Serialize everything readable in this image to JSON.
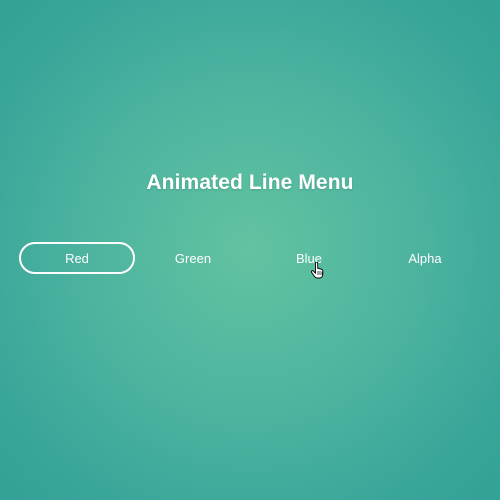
{
  "page": {
    "title": "Animated Line Menu"
  },
  "menu": {
    "items": [
      {
        "label": "Red",
        "active": true
      },
      {
        "label": "Green",
        "active": false
      },
      {
        "label": "Blue",
        "active": false
      },
      {
        "label": "Alpha",
        "active": false
      }
    ]
  },
  "colors": {
    "background_center": "#62c3a1",
    "background_edge": "#34a196",
    "text": "#ffffff",
    "active_border": "#ffffff"
  },
  "icons": {
    "cursor": "hand-pointer-icon"
  }
}
